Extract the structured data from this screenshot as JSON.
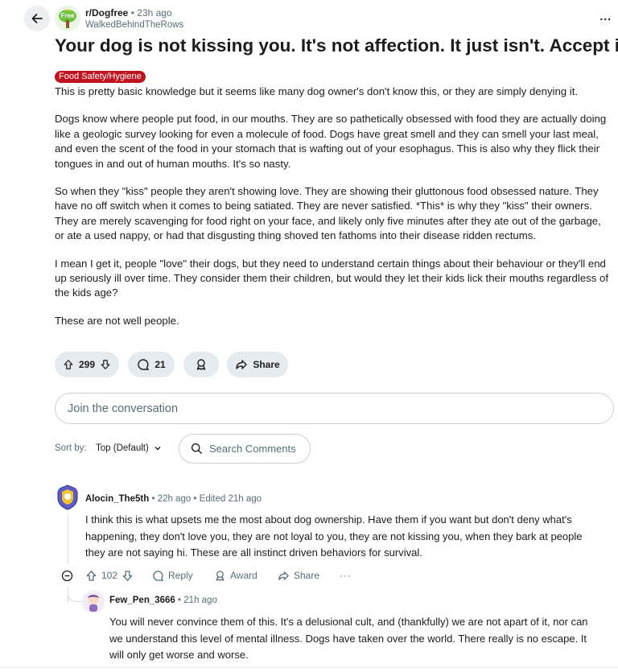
{
  "post": {
    "subreddit": "r/Dogfree",
    "time": "23h ago",
    "separator": "•",
    "author": "WalkedBehindTheRows",
    "subreddit_icon_text": "Free",
    "subreddit_icon_small_text": "Dog",
    "more_label": "...",
    "title": "Your dog is not kissing you. It's not affection. It just isn't. Accept it.",
    "flair": "Food Safety/Hygiene",
    "paragraphs": [
      "This is pretty basic knowledge but it seems like many dog owner's don't know this, or they are simply denying it.",
      "Dogs know where people put food, in our mouths. They are so pathetically obsessed with food they are actually doing like a geologic survey looking for even a molecule of food. Dogs have great smell and they can smell your last meal, and even the scent of the food in your stomach that is wafting out of your esophagus. This is also why they flick their tongues in and out of human mouths. It's so nasty.",
      "So when they \"kiss\" people they aren't showing love. They are showing their gluttonous food obsessed nature. They have no off switch when it comes to being satiated. They are never satisfied. *This* is why they \"kiss\" their owners. They are merely scavenging for food right on your face, and likely only five minutes after they ate out of the garbage, or ate a used nappy, or had that disgusting thing shoved ten fathoms into their disease ridden rectums.",
      "I mean I get it, people \"love\" their dogs, but they need to understand certain things about their behaviour or they'll end up seriously ill over time. They consider them their children, but would they let their kids lick their mouths regardless of the kids age?",
      "These are not well people."
    ],
    "votes": "299",
    "comments": "21",
    "share_label": "Share"
  },
  "composer": {
    "placeholder": "Join the conversation"
  },
  "sort": {
    "label": "Sort by:",
    "value": "Top (Default)"
  },
  "search": {
    "placeholder": "Search Comments"
  },
  "comments": [
    {
      "author": "Alocin_The5th",
      "meta": "22h ago • Edited 21h ago",
      "text": "I think this is what upsets me the most about dog ownership. Have them if you want but don't deny what's happening, they don't love you, they are not loyal to you, they are not kissing you, when they bark at people they are not saying hi. These are all instinct driven behaviors for survival.",
      "votes": "102",
      "reply_label": "Reply",
      "award_label": "Award",
      "share_label": "Share",
      "more_label": "···"
    },
    {
      "author": "Few_Pen_3666",
      "meta": "21h ago",
      "text": "You will never convince them of this. It's a delusional cult, and (thankfully) we are not apart of it, nor can we understand this level of mental illness. Dogs have taken over the world. There really is no escape. It will only get worse and worse."
    }
  ],
  "colors": {
    "flair": "#c1121f",
    "pill_background": "#e5ebee",
    "meta_text": "#576f76"
  }
}
